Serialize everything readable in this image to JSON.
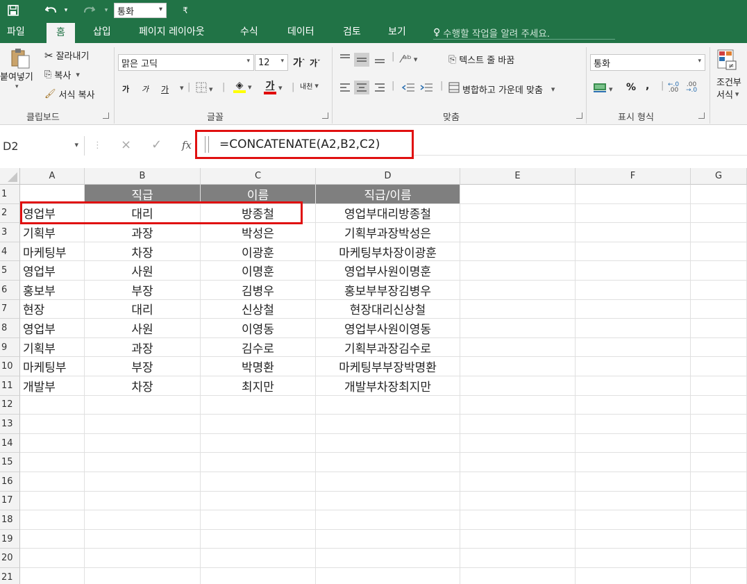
{
  "qat": {
    "save_icon": "save-icon",
    "undo_icon": "undo-icon",
    "redo_icon": "redo-icon",
    "style_combo": "통화",
    "customize_icon": "customize-icon"
  },
  "tabs": {
    "items": [
      "파일",
      "홈",
      "삽입",
      "페이지 레이아웃",
      "수식",
      "데이터",
      "검토",
      "보기"
    ],
    "active": "홈",
    "tell_me": "수행할 작업을 알려 주세요."
  },
  "ribbon": {
    "clipboard": {
      "paste": "붙여넣기",
      "cut": "잘라내기",
      "copy": "복사",
      "format_painter": "서식 복사",
      "label": "클립보드"
    },
    "font": {
      "font_name": "맑은 고딕",
      "font_size": "12",
      "grow": "가",
      "shrink": "가",
      "bold": "가",
      "italic": "가",
      "underline": "가",
      "font_color": "가",
      "phonetic": "내천",
      "label": "글꼴"
    },
    "alignment": {
      "wrap_text": "텍스트 줄 바꿈",
      "merge_center": "병합하고 가운데 맞춤",
      "label": "맞춤"
    },
    "number": {
      "format": "통화",
      "percent": "%",
      "comma": ",",
      "label": "표시 형식"
    },
    "styles": {
      "conditional": "조건부",
      "conditional_sub": "서식"
    }
  },
  "formula_bar": {
    "name_box": "D2",
    "cancel": "×",
    "enter": "✓",
    "fx": "fx",
    "formula": "=CONCATENATE(A2,B2,C2)"
  },
  "sheet": {
    "columns": [
      "A",
      "B",
      "C",
      "D",
      "E",
      "F",
      "G"
    ],
    "row_numbers": [
      "1",
      "2",
      "3",
      "4",
      "5",
      "6",
      "7",
      "8",
      "9",
      "10",
      "11",
      "12",
      "13",
      "14",
      "15",
      "16",
      "17",
      "18",
      "19",
      "20",
      "21"
    ],
    "header_row": [
      "",
      "직급",
      "이름",
      "직급/이름"
    ],
    "rows": [
      [
        "영업부",
        "대리",
        "방종철",
        "영업부대리방종철"
      ],
      [
        "기획부",
        "과장",
        "박성은",
        "기획부과장박성은"
      ],
      [
        "마케팅부",
        "차장",
        "이광훈",
        "마케팅부차장이광훈"
      ],
      [
        "영업부",
        "사원",
        "이명훈",
        "영업부사원이명훈"
      ],
      [
        "홍보부",
        "부장",
        "김병우",
        "홍보부부장김병우"
      ],
      [
        "현장",
        "대리",
        "신상철",
        "현장대리신상철"
      ],
      [
        "영업부",
        "사원",
        "이영동",
        "영업부사원이영동"
      ],
      [
        "기획부",
        "과장",
        "김수로",
        "기획부과장김수로"
      ],
      [
        "마케팅부",
        "부장",
        "박명환",
        "마케팅부부장박명환"
      ],
      [
        "개발부",
        "차장",
        "최지만",
        "개발부차장최지만"
      ]
    ]
  }
}
